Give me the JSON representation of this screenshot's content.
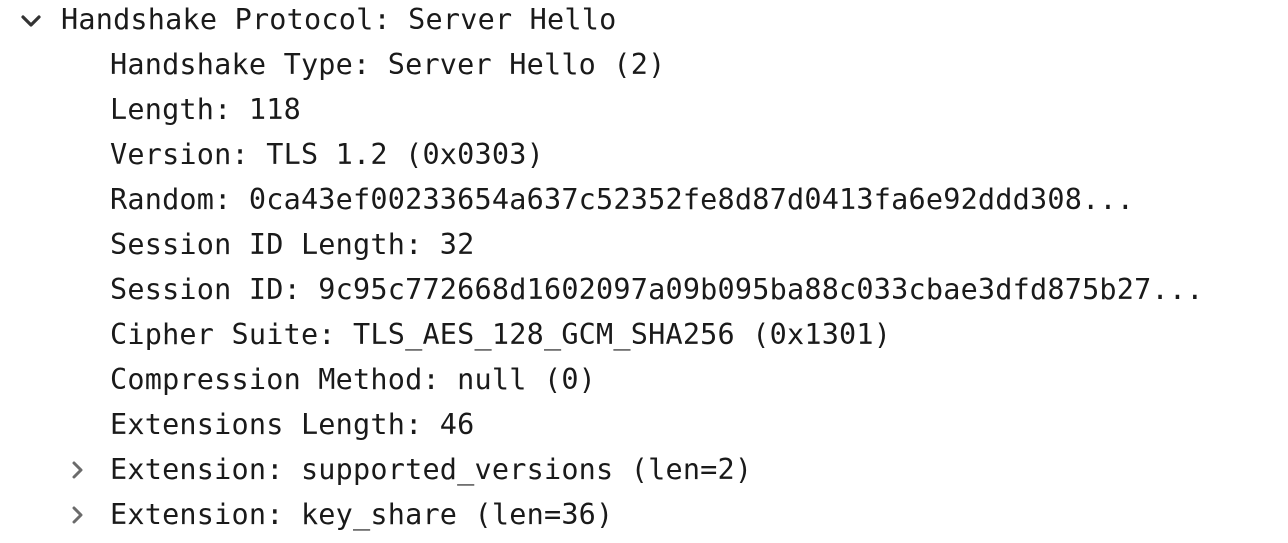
{
  "tree": {
    "root": {
      "label": "Handshake Protocol: Server Hello",
      "expanded": true,
      "toggle_icon": "chevron-down-icon"
    },
    "fields": [
      "Handshake Type: Server Hello (2)",
      "Length: 118",
      "Version: TLS 1.2 (0x0303)",
      "Random: 0ca43ef00233654a637c52352fe8d87d0413fa6e92ddd308...",
      "Session ID Length: 32",
      "Session ID: 9c95c772668d1602097a09b095ba88c033cbae3dfd875b27...",
      "Cipher Suite: TLS_AES_128_GCM_SHA256 (0x1301)",
      "Compression Method: null (0)",
      "Extensions Length: 46"
    ],
    "extensions": [
      {
        "label": "Extension: supported_versions (len=2)",
        "expanded": false,
        "toggle_icon": "chevron-right-icon"
      },
      {
        "label": "Extension: key_share (len=36)",
        "expanded": false,
        "toggle_icon": "chevron-right-icon"
      }
    ]
  },
  "colors": {
    "text": "#1a1a1a",
    "chevron_expanded": "#333333",
    "chevron_collapsed": "#6b6b6b",
    "background": "#ffffff"
  }
}
